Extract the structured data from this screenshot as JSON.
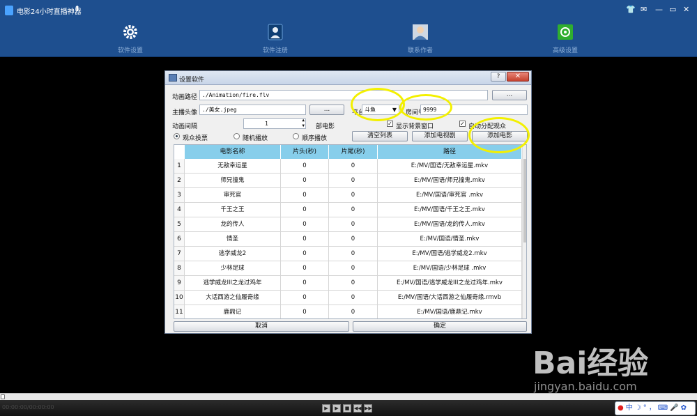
{
  "window": {
    "title": "电影24小时直播神器",
    "pin_glyph": "⬆",
    "controls": [
      "👕",
      "✉",
      "—",
      "▭",
      "✕"
    ]
  },
  "toolbar": {
    "items": [
      {
        "label": "软件设置",
        "icon": "gear-icon"
      },
      {
        "label": "软件注册",
        "icon": "user-key-icon"
      },
      {
        "label": "联系作者",
        "icon": "contact-author-icon"
      },
      {
        "label": "高级设置",
        "icon": "advanced-settings-icon"
      }
    ]
  },
  "dialog": {
    "title": "设置软件",
    "help": "?",
    "close": "✕",
    "animation_path_label": "动画路径",
    "animation_path_value": "./Animation/fire.flv",
    "browse1": "...",
    "anchor_avatar_label": "主播头像",
    "anchor_avatar_value": "./美女.jpeg",
    "browse2": "...",
    "platform_label": "平台",
    "platform_value": "斗鱼",
    "room_label": "房间号",
    "room_value": "9999",
    "interval_label": "动画间隔",
    "interval_value": "1",
    "interval_unit": "部电影",
    "show_bg_label": "显示背景窗口",
    "auto_vote_label": "自动分配观众",
    "mode_vote": "观众投票",
    "mode_random": "随机播放",
    "mode_sequential": "顺序播放",
    "clear_list": "清空列表",
    "add_tv": "添加电视剧",
    "add_movie": "添加电影",
    "cancel": "取消",
    "ok": "确定"
  },
  "table": {
    "columns": [
      "电影名称",
      "片头(秒)",
      "片尾(秒)",
      "路径"
    ],
    "rows": [
      {
        "n": "1",
        "name": "无敌幸运星",
        "head": "0",
        "tail": "0",
        "path": "E:/MV/国语/无敌幸运星.mkv"
      },
      {
        "n": "2",
        "name": "师兄撞鬼",
        "head": "0",
        "tail": "0",
        "path": "E:/MV/国语/师兄撞鬼.mkv"
      },
      {
        "n": "3",
        "name": "审死官",
        "head": "0",
        "tail": "0",
        "path": "E:/MV/国语/审死官 .mkv"
      },
      {
        "n": "4",
        "name": "千王之王",
        "head": "0",
        "tail": "0",
        "path": "E:/MV/国语/千王之王.mkv"
      },
      {
        "n": "5",
        "name": "龙的传人",
        "head": "0",
        "tail": "0",
        "path": "E:/MV/国语/龙的传人.mkv"
      },
      {
        "n": "6",
        "name": "情圣",
        "head": "0",
        "tail": "0",
        "path": "E:/MV/国语/情圣.mkv"
      },
      {
        "n": "7",
        "name": "逃学威龙2",
        "head": "0",
        "tail": "0",
        "path": "E:/MV/国语/逃学威龙2.mkv"
      },
      {
        "n": "8",
        "name": "少林足球",
        "head": "0",
        "tail": "0",
        "path": "E:/MV/国语/少林足球 .mkv"
      },
      {
        "n": "9",
        "name": "逃学威龙III之龙过鸡年",
        "head": "0",
        "tail": "0",
        "path": "E:/MV/国语/逃学威龙III之龙过鸡年.mkv"
      },
      {
        "n": "10",
        "name": "大话西游之仙履奇缘",
        "head": "0",
        "tail": "0",
        "path": "E:/MV/国语/大话西游之仙履奇缘.rmvb"
      },
      {
        "n": "11",
        "name": "鹿鼎记",
        "head": "0",
        "tail": "0",
        "path": "E:/MV/国语/鹿鼎记.mkv"
      }
    ]
  },
  "player": {
    "time": "00:00:00/00:00:00",
    "controls": [
      "▶",
      "▶",
      "■",
      "◀◀",
      "▶▶"
    ]
  },
  "ime": {
    "lang": "中",
    "items": [
      "☽",
      "°",
      "，",
      "⌨",
      "🎤",
      "✿"
    ]
  },
  "watermark": {
    "brand": "Bai经验",
    "url": "jingyan.baidu.com"
  },
  "colors": {
    "titlebar": "#1e4f8f",
    "table_header": "#87ceeb",
    "highlight": "#f3f000"
  }
}
